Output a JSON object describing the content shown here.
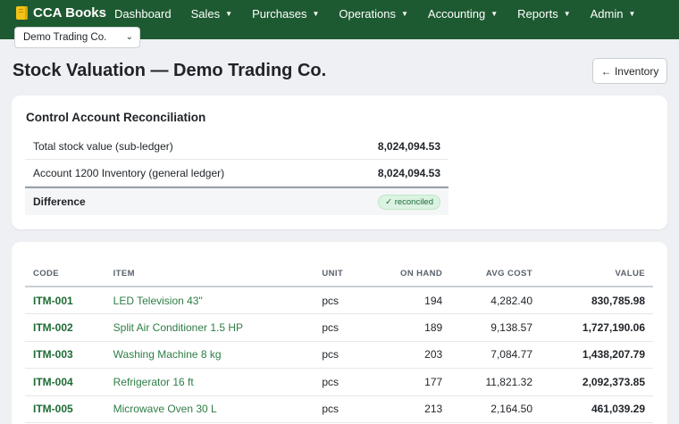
{
  "brand": {
    "name": "CCA Books"
  },
  "nav": {
    "items": [
      {
        "label": "Dashboard",
        "dropdown": false
      },
      {
        "label": "Sales",
        "dropdown": true
      },
      {
        "label": "Purchases",
        "dropdown": true
      },
      {
        "label": "Operations",
        "dropdown": true
      },
      {
        "label": "Accounting",
        "dropdown": true
      },
      {
        "label": "Reports",
        "dropdown": true
      },
      {
        "label": "Admin",
        "dropdown": true
      }
    ],
    "company_select": "Demo Trading Co."
  },
  "page": {
    "title": "Stock Valuation — Demo Trading Co.",
    "back_button": "← Inventory"
  },
  "reconciliation": {
    "title": "Control Account Reconciliation",
    "rows": [
      {
        "label": "Total stock value (sub-ledger)",
        "amount": "8,024,094.53"
      },
      {
        "label": "Account 1200 Inventory (general ledger)",
        "amount": "8,024,094.53"
      }
    ],
    "difference_label": "Difference",
    "status": "✓ reconciled"
  },
  "items_table": {
    "columns": [
      "CODE",
      "ITEM",
      "UNIT",
      "ON HAND",
      "AVG COST",
      "VALUE"
    ],
    "rows": [
      {
        "code": "ITM-001",
        "item": "LED Television 43\"",
        "unit": "pcs",
        "on_hand": "194",
        "avg_cost": "4,282.40",
        "value": "830,785.98"
      },
      {
        "code": "ITM-002",
        "item": "Split Air Conditioner 1.5 HP",
        "unit": "pcs",
        "on_hand": "189",
        "avg_cost": "9,138.57",
        "value": "1,727,190.06"
      },
      {
        "code": "ITM-003",
        "item": "Washing Machine 8 kg",
        "unit": "pcs",
        "on_hand": "203",
        "avg_cost": "7,084.77",
        "value": "1,438,207.79"
      },
      {
        "code": "ITM-004",
        "item": "Refrigerator 16 ft",
        "unit": "pcs",
        "on_hand": "177",
        "avg_cost": "11,821.32",
        "value": "2,092,373.85"
      },
      {
        "code": "ITM-005",
        "item": "Microwave Oven 30 L",
        "unit": "pcs",
        "on_hand": "213",
        "avg_cost": "2,164.50",
        "value": "461,039.29"
      }
    ]
  },
  "colors": {
    "navbar": "#1e5a31",
    "accent": "#1e6b34",
    "badge_bg": "#dbf3e2"
  }
}
